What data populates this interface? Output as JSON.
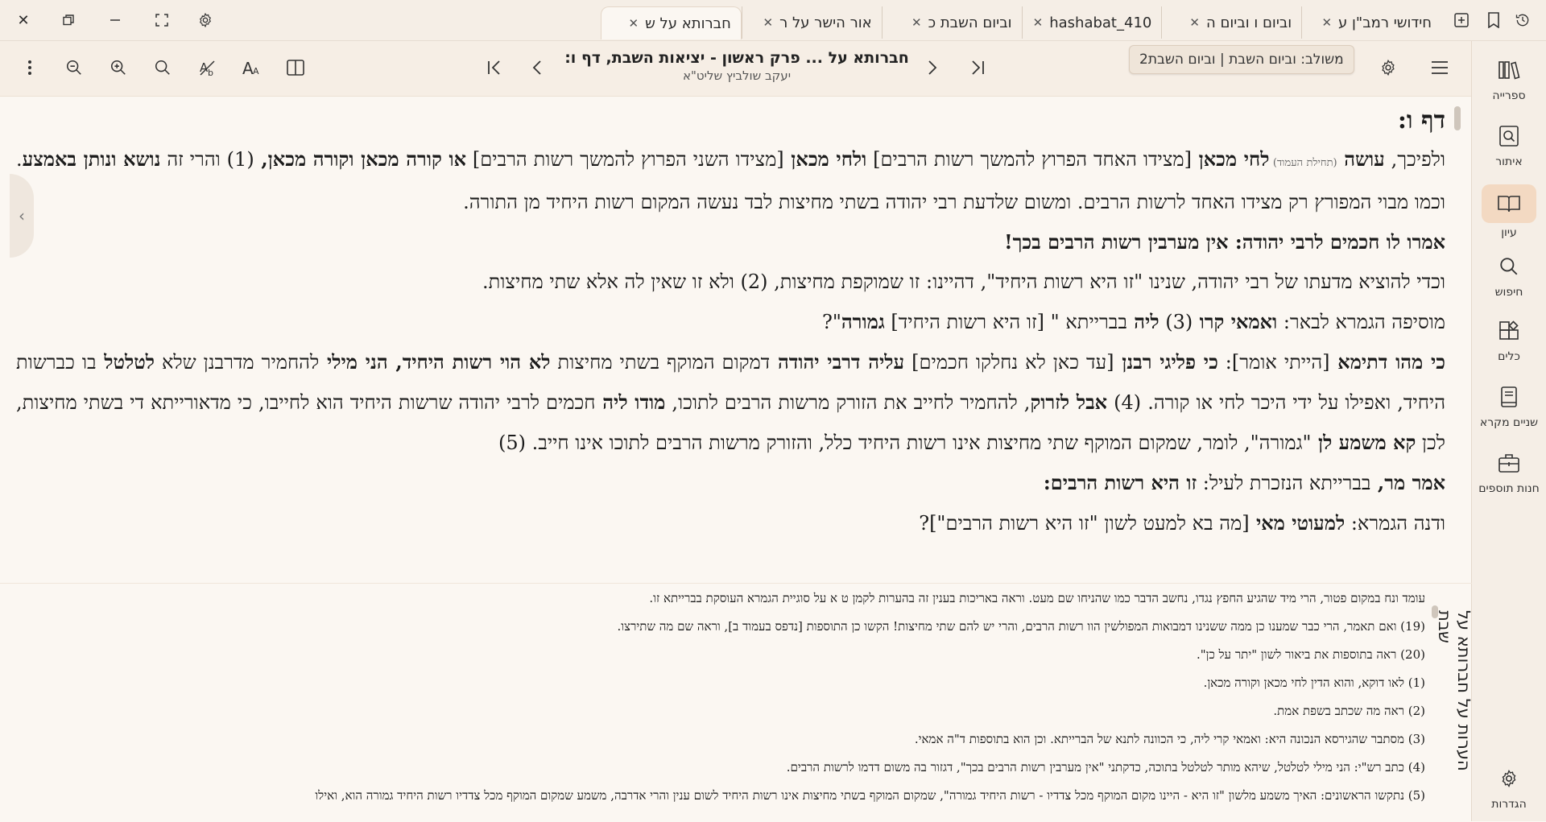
{
  "window": {
    "tabs": [
      {
        "label": "חידושי רמב\"ן ע",
        "active": false
      },
      {
        "label": "וביום ו וביום ה",
        "active": false
      },
      {
        "label": "hashabat_410",
        "active": false
      },
      {
        "label": "וביום השבת כ",
        "active": false
      },
      {
        "label": "אור הישר על ר",
        "active": false
      },
      {
        "label": "חברותא על ש",
        "active": true
      }
    ]
  },
  "toolbar": {
    "title": "חברותא על ... פרק ראשון - יציאות השבת, דף ו:",
    "subtitle": "יעקב שולביץ שליט\"א",
    "tooltip": "משולב: וביום השבת | וביום השבת2"
  },
  "sidebar": {
    "items": [
      {
        "label": "ספרייה",
        "icon": "library-icon"
      },
      {
        "label": "איתור",
        "icon": "locate-icon"
      },
      {
        "label": "עיון",
        "icon": "book-open-icon"
      },
      {
        "label": "חיפוש",
        "icon": "search-icon"
      },
      {
        "label": "כלים",
        "icon": "tools-icon"
      },
      {
        "label": "שניים מקרא",
        "icon": "tanach-icon"
      },
      {
        "label": "חנות תוספים",
        "icon": "store-icon"
      }
    ],
    "settings_label": "הגדרות"
  },
  "content": {
    "daf_heading": "דף ו:",
    "paragraphs": [
      {
        "parts": [
          {
            "t": "ולפיכך, ",
            "b": false
          },
          {
            "t": "עושה ",
            "b": true
          },
          {
            "t": "(תחילת העמוד) ",
            "b": false,
            "small": true
          },
          {
            "t": "לחי מכאן ",
            "b": true
          },
          {
            "t": "[מצידו האחד הפרוץ להמשך רשות הרבים] ",
            "b": false
          },
          {
            "t": "ולחי מכאן ",
            "b": true
          },
          {
            "t": "[מצידו השני הפרוץ להמשך רשות הרבים] ",
            "b": false
          },
          {
            "t": "או קורה מכאן וקורה מכאן, ",
            "b": true
          },
          {
            "t": "(1) והרי זה ",
            "b": false
          },
          {
            "t": "נושא ונותן באמצע",
            "b": true
          },
          {
            "t": ". וכמו מבוי המפורץ רק מצידו האחד לרשות הרבים. ומשום שלדעת רבי יהודה בשתי מחיצות לבד נעשה המקום רשות היחיד מן התורה.",
            "b": false
          }
        ]
      },
      {
        "parts": [
          {
            "t": "אמרו לו חכמים לרבי יהודה: ",
            "b": true
          },
          {
            "t": "אין מערבין רשות הרבים בכך!",
            "b": true
          }
        ]
      },
      {
        "parts": [
          {
            "t": "וכדי להוציא מדעתו של רבי יהודה, שנינו \"זו היא רשות היחיד\", דהיינו: זו שמוקפת מחיצות, (2) ולא זו שאין לה אלא שתי מחיצות.",
            "b": false
          }
        ]
      },
      {
        "parts": [
          {
            "t": "מוסיפה הגמרא לבאר: ",
            "b": false
          },
          {
            "t": "ואמאי קרו ",
            "b": true
          },
          {
            "t": "(3) ",
            "b": false
          },
          {
            "t": "ליה ",
            "b": true
          },
          {
            "t": "בברייתא \" [זו היא רשות היחיד] ",
            "b": false
          },
          {
            "t": "גמורה",
            "b": true
          },
          {
            "t": "\"?",
            "b": false
          }
        ]
      },
      {
        "parts": [
          {
            "t": "כי מהו דתימא ",
            "b": true
          },
          {
            "t": "[הייתי אומר]: ",
            "b": false
          },
          {
            "t": "כי פליגי רבנן ",
            "b": true
          },
          {
            "t": "[עד כאן לא נחלקו חכמים] ",
            "b": false
          },
          {
            "t": "עליה דרבי יהודה ",
            "b": true
          },
          {
            "t": "דמקום המוקף בשתי מחיצות ",
            "b": false
          },
          {
            "t": "לא הוי רשות היחיד, הני מילי ",
            "b": true
          },
          {
            "t": "להחמיר מדרבנן שלא ",
            "b": false
          },
          {
            "t": "לטלטל ",
            "b": true
          },
          {
            "t": "בו כברשות היחיד, ואפילו על ידי היכר לחי או קורה. (4) ",
            "b": false
          },
          {
            "t": "אבל לזרוק",
            "b": true
          },
          {
            "t": ", להחמיר לחייב את הזורק מרשות הרבים לתוכו, ",
            "b": false
          },
          {
            "t": "מודו ליה ",
            "b": true
          },
          {
            "t": "חכמים לרבי יהודה שרשות היחיד הוא לחייבו, כי מדאורייתא די בשתי מחיצות, לכן ",
            "b": false
          },
          {
            "t": "קא משמע לן ",
            "b": true
          },
          {
            "t": "\"גמורה\", לומר, שמקום המוקף שתי מחיצות אינו רשות היחיד כלל, והזורק מרשות הרבים לתוכו אינו חייב. (5)",
            "b": false
          }
        ]
      },
      {
        "parts": [
          {
            "t": "אמר מר, ",
            "b": true
          },
          {
            "t": "בברייתא הנזכרת לעיל: ",
            "b": false
          },
          {
            "t": "זו היא רשות הרבים:",
            "b": true
          }
        ]
      },
      {
        "parts": [
          {
            "t": "ודנה הגמרא: ",
            "b": false
          },
          {
            "t": "למעוטי מאי ",
            "b": true
          },
          {
            "t": "[מה בא למעט לשון \"זו היא רשות הרבים\"]?",
            "b": false
          }
        ]
      }
    ]
  },
  "notes": {
    "side_title": "הערות על חברותא על שבת",
    "items": [
      "עומד ונח במקום פטור, הרי מיד שהגיע החפץ נגדו, נחשב הדבר כמו שהניחו שם מעט. וראה באריכות בענין זה בהערות לקמן ט א על סוגיית הגמרא העוסקת בברייתא זו.",
      "(19) ואם תאמר, הרי כבר שמענו כן ממה ששנינו דמבואות המפולשין הוו רשות הרבים, והרי יש להם שתי מחיצות! הקשו כן התוספות [נדפס בעמוד ב], וראה שם מה שתירצו.",
      "(20) ראה בתוספות את ביאור לשון \"יתר על כן\".",
      "(1) לאו דוקא, והוא הדין לחי מכאן וקורה מכאן.",
      "(2) ראה מה שכתב בשפת אמת.",
      "(3) מסתבר שהגירסא הנכונה היא: ואמאי קרי ליה, כי הכוונה לתנא של הברייתא. וכן הוא בתוספות ד\"ה אמאי.",
      "(4) כתב רש\"י: הני מילי לטלטל, שיהא מותר לטלטל בתוכה, כדקתני \"אין מערבין רשות הרבים בכך\", דגזור בה משום דדמו לרשות הרבים.",
      "(5) נתקשו הראשונים: האיך משמע מלשון \"זו היא - היינו מקום המוקף מכל צדדיו - רשות היחיד גמורה\", שמקום המוקף בשתי מחיצות אינו רשות היחיד לשום ענין והרי אדרבה, משמע שמקום המוקף מכל צדדיו רשות היחיד גמורה הוא, ואילו"
    ]
  },
  "colors": {
    "background": "#fbf7f2",
    "toolbar": "#f6eee5",
    "active_nav": "#f3d9c2"
  }
}
